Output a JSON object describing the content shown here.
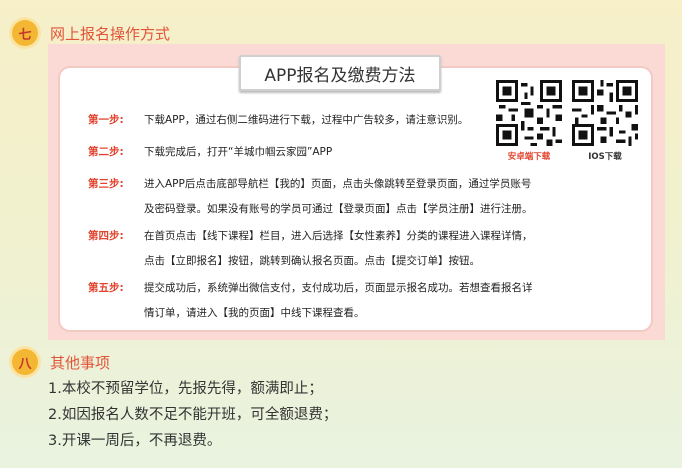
{
  "section7": {
    "badge": "七",
    "title": "网上报名操作方式"
  },
  "card": {
    "title": "APP报名及缴费方法",
    "qr_android_caption": "安卓端下载",
    "qr_ios_caption": "IOS下载",
    "steps": [
      {
        "label": "第一步:",
        "lines": [
          "下载APP，通过右侧二维码进行下载，过程中广告较多，请注意识别。"
        ]
      },
      {
        "label": "第二步:",
        "lines": [
          "下载完成后，打开“羊城巾帼云家园”APP"
        ]
      },
      {
        "label": "第三步:",
        "lines": [
          "进入APP后点击底部导航栏【我的】页面，点击头像跳转至登录页面，通过学员账号",
          "及密码登录。如果没有账号的学员可通过【登录页面】点击【学员注册】进行注册。"
        ]
      },
      {
        "label": "第四步:",
        "lines": [
          "在首页点击【线下课程】栏目，进入后选择【女性素养】分类的课程进入课程详情，",
          "点击【立即报名】按钮，跳转到确认报名页面。点击【提交订单】按钮。"
        ]
      },
      {
        "label": "第五步:",
        "lines": [
          "提交成功后，系统弹出微信支付，支付成功后，页面显示报名成功。若想查看报名详",
          "情订单，请进入【我的页面】中线下课程查看。"
        ]
      }
    ]
  },
  "section8": {
    "badge": "八",
    "title": "其他事项",
    "items": [
      "1.本校不预留学位，先报先得，额满即止；",
      "2.如因报名人数不足不能开班，可全额退费；",
      "3.开课一周后，不再退费。"
    ]
  },
  "colors": {
    "accent_red": "#e2452e",
    "badge_yellow": "#f4b733",
    "panel_pink": "#fbd9d5"
  }
}
